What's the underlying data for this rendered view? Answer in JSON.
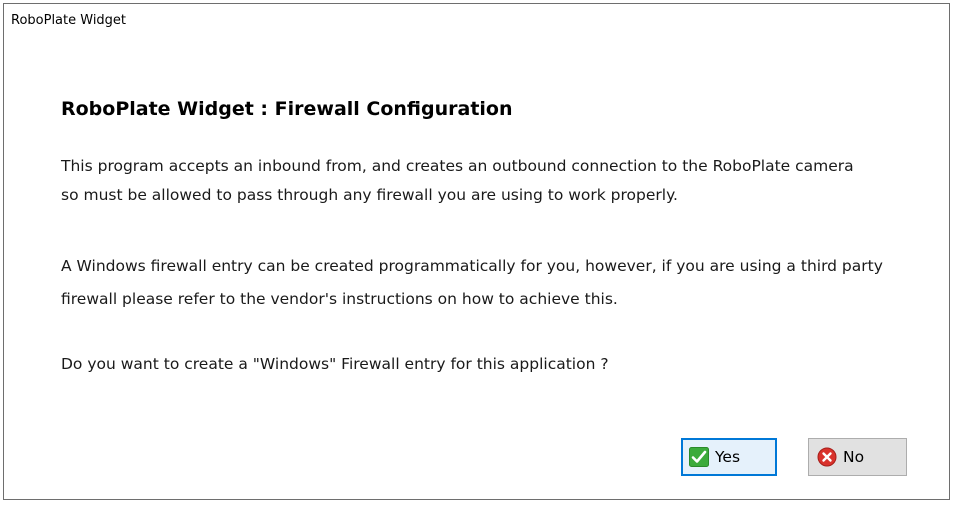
{
  "window": {
    "title": "RoboPlate Widget"
  },
  "dialog": {
    "heading": "RoboPlate Widget : Firewall Configuration",
    "paragraph1": [
      "This program accepts an inbound from, and creates an outbound connection to the RoboPlate camera",
      "so must be allowed to pass through any firewall you are using to work properly."
    ],
    "paragraph2": [
      "A Windows firewall entry can be created programmatically for you, however, if you are using a third party",
      "firewall please refer to the vendor's instructions on how to achieve this."
    ],
    "question": "Do you want to create a \"Windows\" Firewall entry for this application ?"
  },
  "buttons": {
    "yes_label": "Yes",
    "no_label": "No",
    "yes_icon": "checkmark-icon",
    "no_icon": "error-circle-icon"
  },
  "colors": {
    "focus_border": "#0078d7",
    "yes_icon_green": "#3cab3b",
    "no_icon_red": "#d9322c"
  }
}
